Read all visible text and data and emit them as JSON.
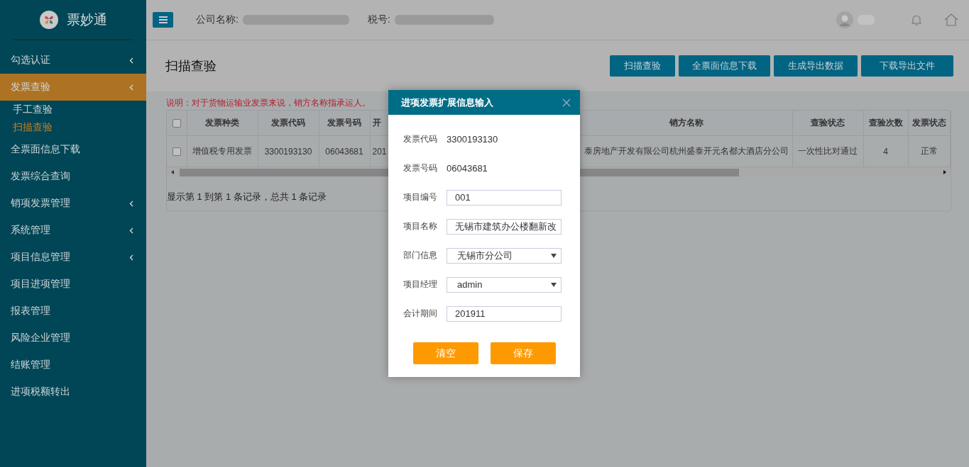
{
  "app": {
    "name": "票妙通"
  },
  "header": {
    "company_label": "公司名称:",
    "tax_label": "税号:"
  },
  "sidebar": {
    "items": [
      {
        "label": "勾选认证",
        "selected": false,
        "collapsible": true
      },
      {
        "label": "发票查验",
        "selected": true,
        "collapsible": true,
        "children": [
          {
            "label": "手工查验",
            "selected": false
          },
          {
            "label": "扫描查验",
            "selected": true
          }
        ]
      },
      {
        "label": "全票面信息下载",
        "selected": false,
        "collapsible": false
      },
      {
        "label": "发票综合查询",
        "selected": false,
        "collapsible": false
      },
      {
        "label": "销项发票管理",
        "selected": false,
        "collapsible": true
      },
      {
        "label": "系统管理",
        "selected": false,
        "collapsible": true
      },
      {
        "label": "项目信息管理",
        "selected": false,
        "collapsible": true
      },
      {
        "label": "项目进项管理",
        "selected": false,
        "collapsible": false
      },
      {
        "label": "报表管理",
        "selected": false,
        "collapsible": false
      },
      {
        "label": "风险企业管理",
        "selected": false,
        "collapsible": false
      },
      {
        "label": "结账管理",
        "selected": false,
        "collapsible": false
      },
      {
        "label": "进项税额转出",
        "selected": false,
        "collapsible": false
      }
    ]
  },
  "page": {
    "title": "扫描查验",
    "actions": [
      "扫描查验",
      "全票面信息下载",
      "生成导出数据",
      "下载导出文件"
    ],
    "note": "说明：对于货物运输业发票来说，销方名称指承运人。"
  },
  "table": {
    "all_checked": false,
    "columns": [
      "发票种类",
      "发票代码",
      "发票号码",
      "开",
      "销方名称",
      "查验状态",
      "查验次数",
      "发票状态"
    ],
    "rows": [
      {
        "checked": false,
        "cells": [
          "增值税专用发票",
          "3300193130",
          "06043681",
          "201",
          "泰房地产开发有限公司杭州盛泰开元名都大酒店分公司",
          "一次性比对通过",
          "4",
          "正常"
        ]
      }
    ],
    "footer": "显示第 1 到第 1 条记录，总共 1 条记录"
  },
  "dialog": {
    "title": "进项发票扩展信息输入",
    "fields": [
      {
        "kind": "text",
        "label": "发票代码",
        "value": "3300193130"
      },
      {
        "kind": "text",
        "label": "发票号码",
        "value": "06043681"
      },
      {
        "kind": "input",
        "label": "项目编号",
        "value": "001"
      },
      {
        "kind": "input",
        "label": "项目名称",
        "value": "无锡市建筑办公楼翻新改"
      },
      {
        "kind": "select",
        "label": "部门信息",
        "value": "无锡市分公司"
      },
      {
        "kind": "select",
        "label": "项目经理",
        "value": "admin"
      },
      {
        "kind": "input",
        "label": "会计期间",
        "value": "201911"
      }
    ],
    "buttons": [
      "清空",
      "保存"
    ]
  }
}
